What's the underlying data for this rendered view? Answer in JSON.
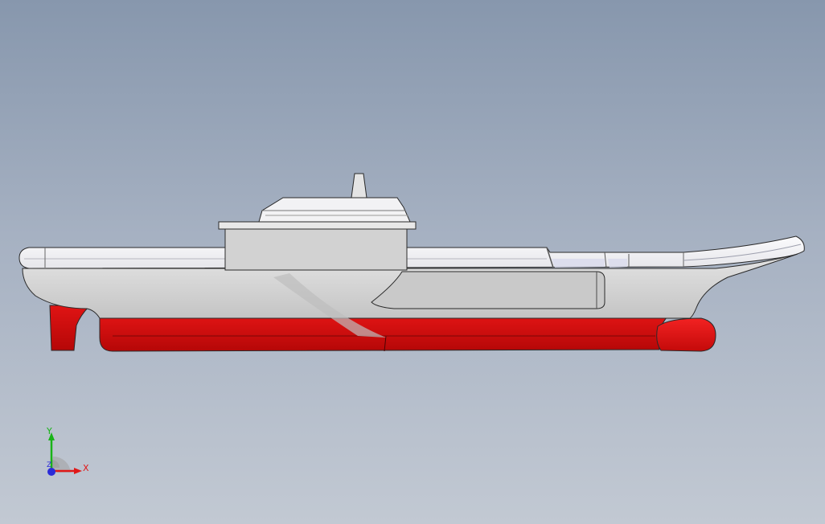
{
  "viewport": {
    "background_top": "#8797ad",
    "background_bottom": "#c2c9d3"
  },
  "model": {
    "description_icon": "aircraft-carrier-model",
    "colors": {
      "deck": "#f4f4f6",
      "hull": "#d2d2d2",
      "island": "#d0d0d0",
      "antifouling": "#d40b0b",
      "bulb": "#e31010",
      "edge": "#2a2a2a"
    }
  },
  "triad": {
    "x_label": "X",
    "y_label": "Y",
    "z_label": "Z",
    "x_color": "#e01818",
    "y_color": "#19b319",
    "z_color": "#2b2bd8"
  }
}
